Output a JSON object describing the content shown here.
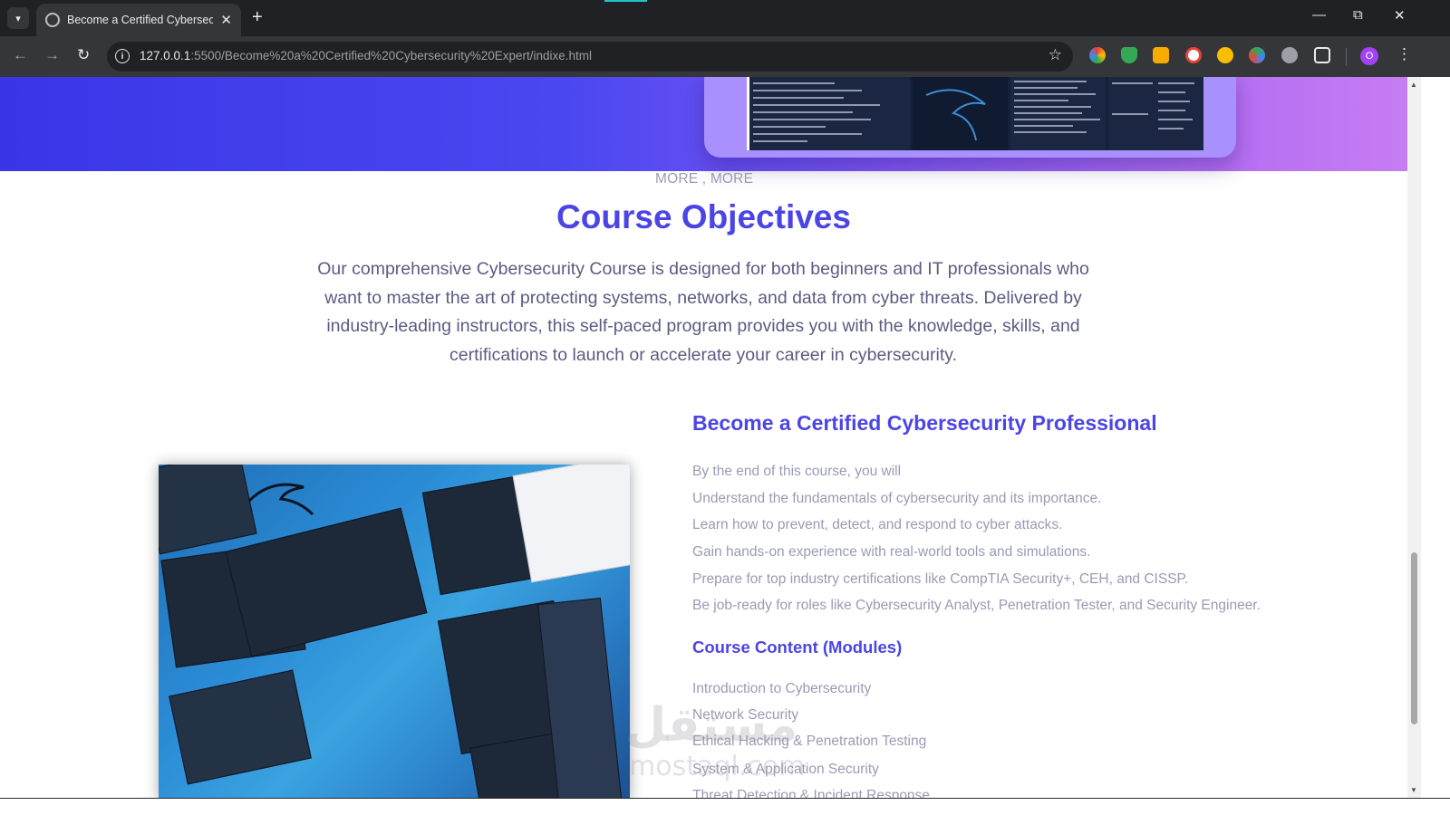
{
  "browser": {
    "tab_title": "Become a Certified Cybersecuri",
    "new_tab_symbol": "+",
    "url_host": "127.0.0.1",
    "url_rest": ":5500/Become%20a%20Certified%20Cybersecurity%20Expert/indixe.html",
    "profile_initial": "O",
    "icons": [
      "tab-search-icon",
      "close-icon",
      "back-icon",
      "forward-icon",
      "reload-icon",
      "site-info-icon",
      "bookmark-star-icon",
      "extensions-icon",
      "menu-icon"
    ]
  },
  "page": {
    "more_link": "MORE , MORE",
    "objectives_title": "Course Objectives",
    "objectives_desc": "Our comprehensive Cybersecurity Course is designed for both beginners and IT professionals who want to master the art of protecting systems, networks, and data from cyber threats. Delivered by industry-leading instructors, this self-paced program provides you with the knowledge, skills, and certifications to launch or accelerate your career in cybersecurity.",
    "cert_title": "Become a Certified Cybersecurity Professional",
    "outcomes": [
      "By the end of this course, you will",
      "Understand the fundamentals of cybersecurity and its importance.",
      "Learn how to prevent, detect, and respond to cyber attacks.",
      "Gain hands-on experience with real-world tools and simulations.",
      "Prepare for top industry certifications like CompTIA Security+, CEH, and CISSP.",
      "Be job-ready for roles like Cybersecurity Analyst, Penetration Tester, and Security Engineer."
    ],
    "modules_title": "Course Content (Modules)",
    "modules": [
      "Introduction to Cybersecurity",
      "Network Security",
      "Ethical Hacking & Penetration Testing",
      "System & Application Security",
      "Threat Detection & Incident Response"
    ],
    "watermark_arabic": "مستقل",
    "watermark_latin": "mostaql.com"
  },
  "colors": {
    "accent": "#4b45e6",
    "muted_text": "#9a9bb5",
    "body_text": "#5a5c82",
    "hero_start": "#3a36e8",
    "hero_end": "#c67cf2"
  }
}
